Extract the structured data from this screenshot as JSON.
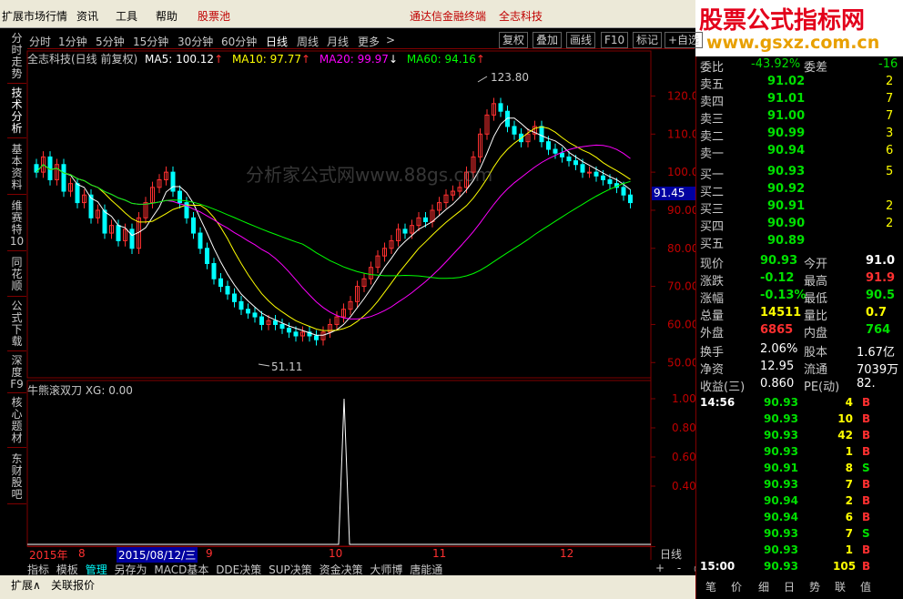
{
  "menu": {
    "items": [
      "扩展市场行情",
      "资讯",
      "工具",
      "帮助"
    ],
    "stock_pool": "股票池",
    "center_link": "通达信金融终端",
    "stock_name": "全志科技",
    "logo_line1": "股票公式指标网",
    "logo_line2": "www.gsxz.com.cn"
  },
  "sidebar": {
    "items": [
      {
        "label": "分时走势"
      },
      {
        "label": "技术分析"
      },
      {
        "label": "基本资料"
      },
      {
        "label": "维赛特10"
      },
      {
        "label": "同花顺"
      },
      {
        "label": "公式下载"
      },
      {
        "label": "深度F9"
      },
      {
        "label": "核心题材"
      },
      {
        "label": "东财股吧"
      }
    ]
  },
  "toolbar": {
    "periods": [
      "分时",
      "1分钟",
      "5分钟",
      "15分钟",
      "30分钟",
      "60分钟",
      "日线",
      "周线",
      "月线",
      "更多"
    ],
    "active_period": "日线",
    "more_arrow": ">",
    "buttons": [
      "复权",
      "叠加",
      "画线",
      "F10",
      "标记",
      "+自选"
    ]
  },
  "chart_header": {
    "name": "全志科技(日线 前复权)",
    "ma5": "MA5: 100.12",
    "ma10": "MA10: 97.77",
    "ma20": "MA20: 99.97",
    "ma60": "MA60: 94.16",
    "high_label": "123.80",
    "low_label": "51.11",
    "current_tag": "91.45",
    "indicator_title": "牛熊滚双刀 XG: 0.00",
    "price_axis": [
      "120.0",
      "110.0",
      "100.0",
      "90.00",
      "80.00",
      "70.00",
      "60.00",
      "50.00"
    ],
    "indicator_axis": [
      "1.00",
      "0.80",
      "0.60",
      "0.40"
    ],
    "date_labels": [
      "2015年",
      "8",
      "2015/08/12/三",
      "9",
      "10",
      "11",
      "12"
    ],
    "period_label": "日线",
    "watermark": "分析家公式网www.88gs.com"
  },
  "bottom_tabs": [
    "指标",
    "模板",
    "管理",
    "另存为",
    "MACD基本",
    "DDE决策",
    "SUP决策",
    "资金决策",
    "大师博",
    "唐能通"
  ],
  "bottom_controls": [
    "+",
    "-",
    "○"
  ],
  "status": {
    "items": [
      "扩展∧",
      "关联报价"
    ]
  },
  "quote": {
    "weibi_label": "委比",
    "weibi": "-43.92%",
    "weicha_label": "委差",
    "weicha": "-16",
    "asks": [
      {
        "label": "卖五",
        "price": "91.02",
        "vol": "2"
      },
      {
        "label": "卖四",
        "price": "91.01",
        "vol": "7"
      },
      {
        "label": "卖三",
        "price": "91.00",
        "vol": "7"
      },
      {
        "label": "卖二",
        "price": "90.99",
        "vol": "3"
      },
      {
        "label": "卖一",
        "price": "90.94",
        "vol": "6"
      }
    ],
    "bids": [
      {
        "label": "买一",
        "price": "90.93",
        "vol": "5"
      },
      {
        "label": "买二",
        "price": "90.92",
        "vol": ""
      },
      {
        "label": "买三",
        "price": "90.91",
        "vol": "2"
      },
      {
        "label": "买四",
        "price": "90.90",
        "vol": "2"
      },
      {
        "label": "买五",
        "price": "90.89",
        "vol": ""
      }
    ],
    "stats": [
      {
        "l1": "现价",
        "v1": "90.93",
        "l2": "今开",
        "v2": "91.0"
      },
      {
        "l1": "涨跌",
        "v1": "-0.12",
        "l2": "最高",
        "v2": "91.9"
      },
      {
        "l1": "涨幅",
        "v1": "-0.13%",
        "l2": "最低",
        "v2": "90.5"
      },
      {
        "l1": "总量",
        "v1": "14511",
        "l2": "量比",
        "v2": "0.7"
      },
      {
        "l1": "外盘",
        "v1": "6865",
        "l2": "内盘",
        "v2": "764"
      }
    ],
    "stats2": [
      {
        "l1": "换手",
        "v1": "2.06%",
        "l2": "股本",
        "v2": "1.67亿"
      },
      {
        "l1": "净资",
        "v1": "12.95",
        "l2": "流通",
        "v2": "7039万"
      },
      {
        "l1": "收益(三)",
        "v1": "0.860",
        "l2": "PE(动)",
        "v2": "82."
      }
    ],
    "ticks": [
      {
        "time": "14:56",
        "price": "90.93",
        "vol": "4",
        "side": "B"
      },
      {
        "time": "",
        "price": "90.93",
        "vol": "10",
        "side": "B"
      },
      {
        "time": "",
        "price": "90.93",
        "vol": "42",
        "side": "B"
      },
      {
        "time": "",
        "price": "90.93",
        "vol": "1",
        "side": "B"
      },
      {
        "time": "",
        "price": "90.91",
        "vol": "8",
        "side": "S"
      },
      {
        "time": "",
        "price": "90.93",
        "vol": "7",
        "side": "B"
      },
      {
        "time": "",
        "price": "90.94",
        "vol": "2",
        "side": "B"
      },
      {
        "time": "",
        "price": "90.94",
        "vol": "6",
        "side": "B"
      },
      {
        "time": "",
        "price": "90.93",
        "vol": "7",
        "side": "S"
      },
      {
        "time": "",
        "price": "90.93",
        "vol": "1",
        "side": "B"
      },
      {
        "time": "15:00",
        "price": "90.93",
        "vol": "105",
        "side": "B"
      }
    ],
    "tabs": [
      "笔",
      "价",
      "细",
      "日",
      "势",
      "联",
      "值"
    ]
  },
  "colors": {
    "up": "#ff3030",
    "down": "#00ffff",
    "ma5": "#ffffff",
    "ma10": "#ffff00",
    "ma20": "#ff00ff",
    "ma60": "#00ff00",
    "axis": "#800000"
  }
}
